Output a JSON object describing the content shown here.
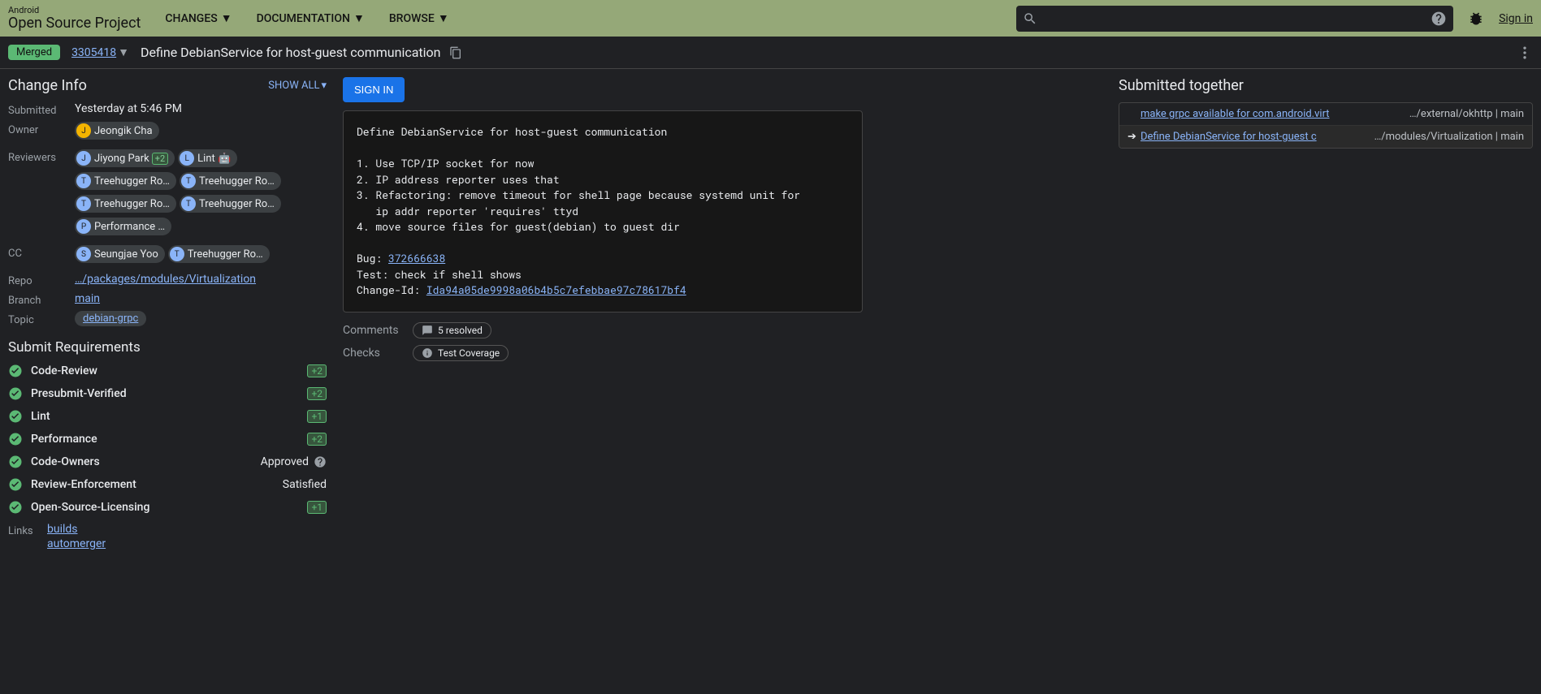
{
  "header": {
    "logo_top": "Android",
    "logo_bottom": "Open Source Project",
    "nav": [
      "CHANGES",
      "DOCUMENTATION",
      "BROWSE"
    ],
    "search_placeholder": "",
    "signin": "Sign in"
  },
  "subheader": {
    "status": "Merged",
    "change_number": "3305418",
    "subject": "Define DebianService for host-guest communication"
  },
  "change_info": {
    "title": "Change Info",
    "show_all": "SHOW ALL",
    "rows": {
      "submitted_label": "Submitted",
      "submitted_value": "Yesterday at 5:46 PM",
      "owner_label": "Owner",
      "owner_value": "Jeongik Cha",
      "reviewers_label": "Reviewers",
      "reviewers": [
        {
          "name": "Jiyong Park",
          "vote": "+2"
        },
        {
          "name": "Lint 🤖",
          "vote": ""
        },
        {
          "name": "Treehugger Ro…",
          "vote": ""
        },
        {
          "name": "Treehugger Ro…",
          "vote": ""
        },
        {
          "name": "Treehugger Ro…",
          "vote": ""
        },
        {
          "name": "Treehugger Ro…",
          "vote": ""
        },
        {
          "name": "Performance …",
          "vote": ""
        }
      ],
      "cc_label": "CC",
      "cc": [
        {
          "name": "Seungjae Yoo"
        },
        {
          "name": "Treehugger Ro…"
        }
      ],
      "repo_label": "Repo",
      "repo_value": "…/packages/modules/Virtualization",
      "branch_label": "Branch",
      "branch_value": "main",
      "topic_label": "Topic",
      "topic_value": "debian-grpc"
    }
  },
  "requirements": {
    "title": "Submit Requirements",
    "rows": [
      {
        "label": "Code-Review",
        "value": "+2",
        "type": "vote"
      },
      {
        "label": "Presubmit-Verified",
        "value": "+2",
        "type": "vote"
      },
      {
        "label": "Lint",
        "value": "+1",
        "type": "vote"
      },
      {
        "label": "Performance",
        "value": "+2",
        "type": "vote"
      },
      {
        "label": "Code-Owners",
        "value": "Approved",
        "type": "text-help"
      },
      {
        "label": "Review-Enforcement",
        "value": "Satisfied",
        "type": "text"
      },
      {
        "label": "Open-Source-Licensing",
        "value": "+1",
        "type": "vote"
      }
    ]
  },
  "links": {
    "label": "Links",
    "items": [
      "builds",
      "automerger"
    ]
  },
  "main": {
    "signin_btn": "SIGN IN",
    "commit_message_pre": "Define DebianService for host-guest communication\n\n1. Use TCP/IP socket for now\n2. IP address reporter uses that\n3. Refactoring: remove timeout for shell page because systemd unit for\n   ip addr reporter 'requires' ttyd\n4. move source files for guest(debian) to guest dir\n\nBug: ",
    "bug_link": "372666638",
    "commit_message_mid": "\nTest: check if shell shows\nChange-Id: ",
    "change_id": "Ida94a05de9998a06b4b5c7efebbae97c78617bf4",
    "comments_label": "Comments",
    "comments_pill": "5 resolved",
    "checks_label": "Checks",
    "checks_pill": "Test Coverage"
  },
  "submitted_together": {
    "title": "Submitted together",
    "items": [
      {
        "title": "make grpc available for com.android.virt",
        "path": "…/external/okhttp | main",
        "arrow": ""
      },
      {
        "title": "Define DebianService for host-guest c",
        "path": "…/modules/Virtualization | main",
        "arrow": "➔"
      }
    ]
  }
}
